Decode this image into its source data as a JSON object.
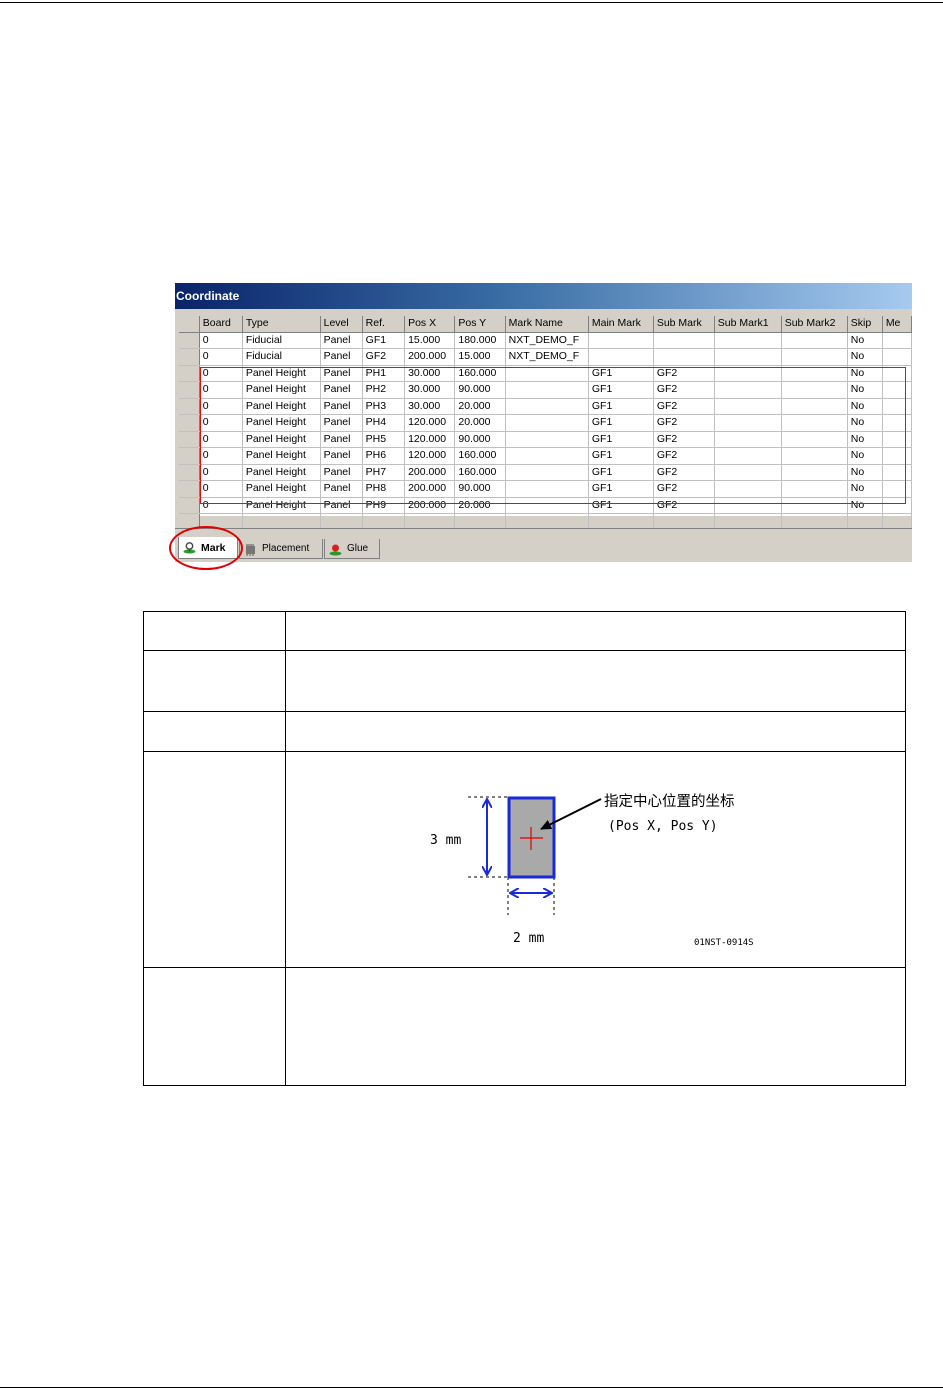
{
  "window": {
    "title": "Coordinate"
  },
  "table": {
    "columns": [
      "Board",
      "Type",
      "Level",
      "Ref.",
      "Pos X",
      "Pos Y",
      "Mark Name",
      "Main Mark",
      "Sub Mark",
      "Sub Mark1",
      "Sub Mark2",
      "Skip",
      "Me"
    ],
    "rows": [
      [
        "0",
        "Fiducial",
        "Panel",
        "GF1",
        "15.000",
        "180.000",
        "NXT_DEMO_F",
        "",
        "",
        "",
        "",
        "No",
        ""
      ],
      [
        "0",
        "Fiducial",
        "Panel",
        "GF2",
        "200.000",
        "15.000",
        "NXT_DEMO_F",
        "",
        "",
        "",
        "",
        "No",
        ""
      ],
      [
        "0",
        "Panel Height",
        "Panel",
        "PH1",
        "30.000",
        "160.000",
        "",
        "GF1",
        "GF2",
        "",
        "",
        "No",
        ""
      ],
      [
        "0",
        "Panel Height",
        "Panel",
        "PH2",
        "30.000",
        "90.000",
        "",
        "GF1",
        "GF2",
        "",
        "",
        "No",
        ""
      ],
      [
        "0",
        "Panel Height",
        "Panel",
        "PH3",
        "30.000",
        "20.000",
        "",
        "GF1",
        "GF2",
        "",
        "",
        "No",
        ""
      ],
      [
        "0",
        "Panel Height",
        "Panel",
        "PH4",
        "120.000",
        "20.000",
        "",
        "GF1",
        "GF2",
        "",
        "",
        "No",
        ""
      ],
      [
        "0",
        "Panel Height",
        "Panel",
        "PH5",
        "120.000",
        "90.000",
        "",
        "GF1",
        "GF2",
        "",
        "",
        "No",
        ""
      ],
      [
        "0",
        "Panel Height",
        "Panel",
        "PH6",
        "120.000",
        "160.000",
        "",
        "GF1",
        "GF2",
        "",
        "",
        "No",
        ""
      ],
      [
        "0",
        "Panel Height",
        "Panel",
        "PH7",
        "200.000",
        "160.000",
        "",
        "GF1",
        "GF2",
        "",
        "",
        "No",
        ""
      ],
      [
        "0",
        "Panel Height",
        "Panel",
        "PH8",
        "200.000",
        "90.000",
        "",
        "GF1",
        "GF2",
        "",
        "",
        "No",
        ""
      ],
      [
        "0",
        "Panel Height",
        "Panel",
        "PH9",
        "200.000",
        "20.000",
        "",
        "GF1",
        "GF2",
        "",
        "",
        "No",
        ""
      ]
    ]
  },
  "tabs": [
    {
      "label": "Mark",
      "icon": "mark-icon",
      "active": true
    },
    {
      "label": "Placement",
      "icon": "placement-icon",
      "active": false
    },
    {
      "label": "Glue",
      "icon": "glue-icon",
      "active": false
    }
  ],
  "diagram": {
    "height_label": "3 mm",
    "width_label": "2 mm",
    "center_label_line1": "指定中心位置的坐标",
    "center_label_line2": "(Pos X, Pos Y)",
    "figure_code": "01NST-0914S"
  },
  "colors": {
    "highlight": "#e01010",
    "diagram_blue": "#1a2ad8",
    "mark_fill": "#a9a9a9",
    "title_bar": "#0a246a"
  }
}
